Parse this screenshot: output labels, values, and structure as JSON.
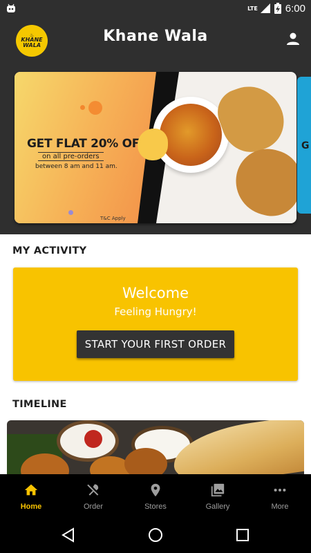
{
  "status_bar": {
    "network": "LTE",
    "time": "6:00"
  },
  "app_bar": {
    "logo_top": "KHANE",
    "logo_bottom": "WALA",
    "title": "Khane Wala",
    "profile_icon": "account-icon"
  },
  "banner": {
    "headline": "GET FLAT 20% OFF",
    "subline": "on all pre-orders",
    "time_note": "between 8 am and 11 am.",
    "terms": "T&C Apply",
    "next_peek": "G"
  },
  "activity": {
    "section_title": "MY ACTIVITY",
    "welcome": "Welcome",
    "subtitle": "Feeling Hungry!",
    "button_label": "START YOUR FIRST ORDER"
  },
  "timeline": {
    "section_title": "TIMELINE"
  },
  "bottom_nav": {
    "items": [
      {
        "label": "Home",
        "icon": "home-icon",
        "active": true
      },
      {
        "label": "Order",
        "icon": "cutlery-icon",
        "active": false
      },
      {
        "label": "Stores",
        "icon": "location-pin-icon",
        "active": false
      },
      {
        "label": "Gallery",
        "icon": "gallery-icon",
        "active": false
      },
      {
        "label": "More",
        "icon": "more-dots-icon",
        "active": false
      }
    ]
  },
  "colors": {
    "accent": "#f8c300",
    "dark": "#2f2f2f",
    "nav_active": "#f8c300",
    "nav_inactive": "#9e9e9e"
  }
}
